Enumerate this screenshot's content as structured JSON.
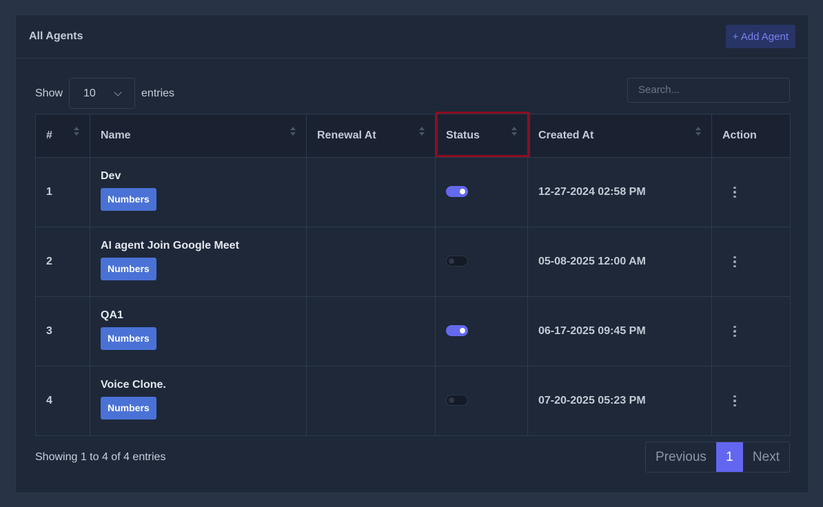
{
  "card": {
    "title": "All Agents",
    "add_label": "+ Add Agent"
  },
  "controls": {
    "show_label": "Show",
    "entries_value": "10",
    "entries_label": "entries",
    "search_placeholder": "Search..."
  },
  "table": {
    "headers": [
      "#",
      "Name",
      "Renewal At",
      "Status",
      "Created At",
      "Action"
    ],
    "rows": [
      {
        "index": "1",
        "name": "Dev",
        "badge": "Numbers",
        "renewal": "",
        "status": "on",
        "created": "12-27-2024 02:58 PM"
      },
      {
        "index": "2",
        "name": "AI agent Join Google Meet",
        "badge": "Numbers",
        "renewal": "",
        "status": "off",
        "created": "05-08-2025 12:00 AM"
      },
      {
        "index": "3",
        "name": "QA1",
        "badge": "Numbers",
        "renewal": "",
        "status": "on",
        "created": "06-17-2025 09:45 PM"
      },
      {
        "index": "4",
        "name": "Voice Clone.",
        "badge": "Numbers",
        "renewal": "",
        "status": "off",
        "created": "07-20-2025 05:23 PM"
      }
    ]
  },
  "footer": {
    "info": "Showing 1 to 4 of 4 entries",
    "prev": "Previous",
    "current_page": "1",
    "next": "Next"
  },
  "colors": {
    "accent": "#6366f1",
    "badge": "#4a72d6",
    "highlight": "#8b0e1f",
    "toggle_on": "#6469ee"
  }
}
